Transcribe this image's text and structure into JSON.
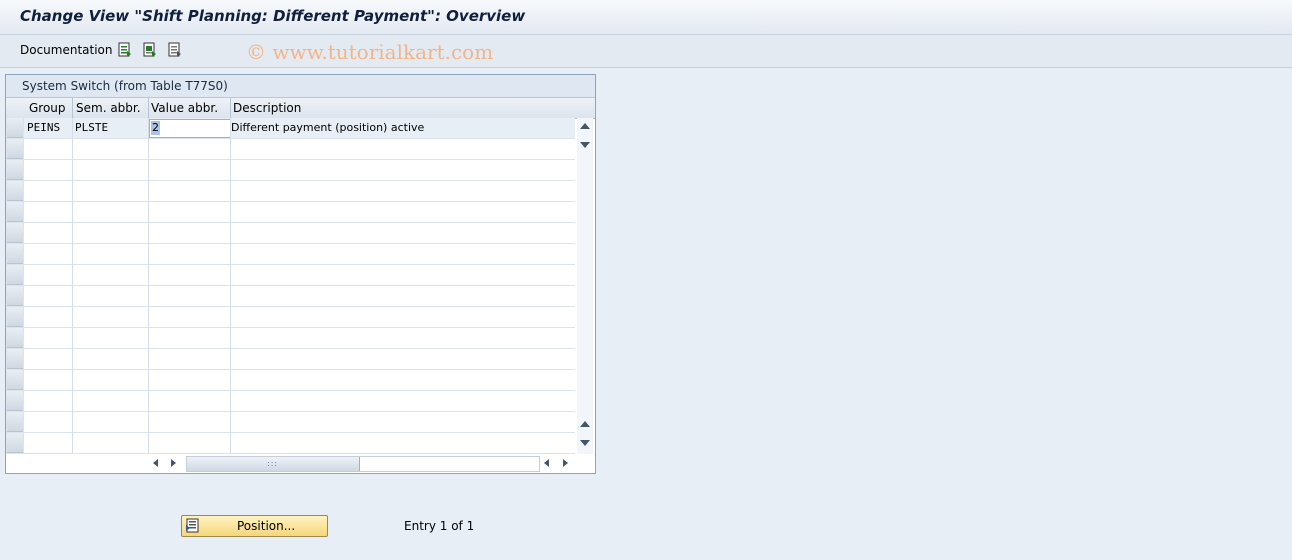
{
  "window": {
    "title": "Change View \"Shift Planning: Different Payment\": Overview"
  },
  "toolbar": {
    "documentation_label": "Documentation",
    "icons": [
      "select-all-icon",
      "select-block-icon",
      "deselect-all-icon"
    ],
    "watermark": "© www.tutorialkart.com"
  },
  "table": {
    "title": "System Switch (from Table T77S0)",
    "columns": [
      "Group",
      "Sem. abbr.",
      "Value abbr.",
      "Description"
    ],
    "rows": [
      {
        "group": "PEINS",
        "sem_abbr": "PLSTE",
        "value_abbr": "2",
        "description": "Different payment (position) active"
      }
    ]
  },
  "footer": {
    "position_button_label": "Position...",
    "entry_text": "Entry 1 of 1"
  },
  "colors": {
    "accent": "#f5d77a",
    "background": "#e8eef5"
  }
}
